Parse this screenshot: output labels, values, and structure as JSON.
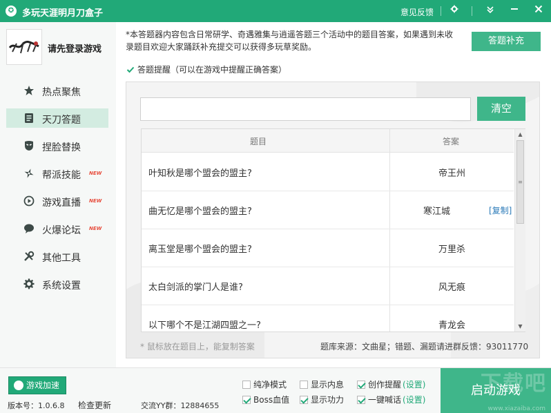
{
  "titlebar": {
    "title": "多玩天涯明月刀盒子",
    "feedback": "意见反馈",
    "settings_icon": "gear-icon",
    "minimize_to_tray_icon": "chevron-down-icon",
    "minimize_icon": "minus-icon",
    "close_icon": "close-icon"
  },
  "sidebar": {
    "login_text": "请先登录游戏",
    "items": [
      {
        "label": "热点聚焦",
        "icon": "star-icon"
      },
      {
        "label": "天刀答题",
        "icon": "quiz-icon"
      },
      {
        "label": "捏脸替换",
        "icon": "mask-icon"
      },
      {
        "label": "帮派技能",
        "icon": "shuriken-icon",
        "badge": "NEW"
      },
      {
        "label": "游戏直播",
        "icon": "play-icon",
        "badge": "NEW"
      },
      {
        "label": "火爆论坛",
        "icon": "chat-icon",
        "badge": "NEW"
      },
      {
        "label": "其他工具",
        "icon": "tools-icon"
      },
      {
        "label": "系统设置",
        "icon": "gear-icon"
      }
    ],
    "active_index": 1
  },
  "main": {
    "notice": "*本答题器内容包含日常研学、奇遇雅集与逍遥答题三个活动中的题目答案，如果遇到未收录题目欢迎大家踊跃补充提交可以获得多玩草奖励。",
    "supplement_button": "答题补充",
    "remind_label": "答题提醒（可以在游戏中提醒正确答案）",
    "remind_checked": true,
    "search": {
      "value": "",
      "placeholder": ""
    },
    "clear_button": "清空",
    "table": {
      "headers": [
        "题目",
        "答案"
      ],
      "rows": [
        {
          "question": "叶知秋是哪个盟会的盟主?",
          "answer": "帝王州"
        },
        {
          "question": "曲无忆是哪个盟会的盟主?",
          "answer": "寒江城",
          "copy": "[复制]"
        },
        {
          "question": "离玉堂是哪个盟会的盟主?",
          "answer": "万里杀"
        },
        {
          "question": "太白剑派的掌门人是谁?",
          "answer": "风无痕"
        },
        {
          "question": "以下哪个不是江湖四盟之一?",
          "answer": "青龙会"
        }
      ]
    },
    "hint": "* 鼠标放在题目上，能复制答案",
    "source": "题库来源：文曲星；错题、漏题请进群反馈：93011770"
  },
  "bottombar": {
    "accel_button": "游戏加速",
    "version": "版本号：1.0.6.8",
    "check_update": "检查更新",
    "qq_group": "交流YY群：12884655",
    "options": [
      {
        "label": "纯净模式",
        "checked": false
      },
      {
        "label": "显示内息",
        "checked": false
      },
      {
        "label": "创作提醒",
        "checked": true,
        "setting": "(设置)"
      },
      {
        "label": "Boss血值",
        "checked": true
      },
      {
        "label": "显示功力",
        "checked": true
      },
      {
        "label": "一键喊话",
        "checked": true,
        "setting": "(设置)"
      }
    ],
    "start_button": "启动游戏",
    "watermark": "下载吧",
    "watermark_url": "www.xiazaiba.com"
  },
  "colors": {
    "brand_green": "#21a978",
    "button_green": "#3fb68a",
    "active_nav": "#d3ece1",
    "link_blue": "#2a7ab8",
    "new_badge": "#e74c3c"
  }
}
